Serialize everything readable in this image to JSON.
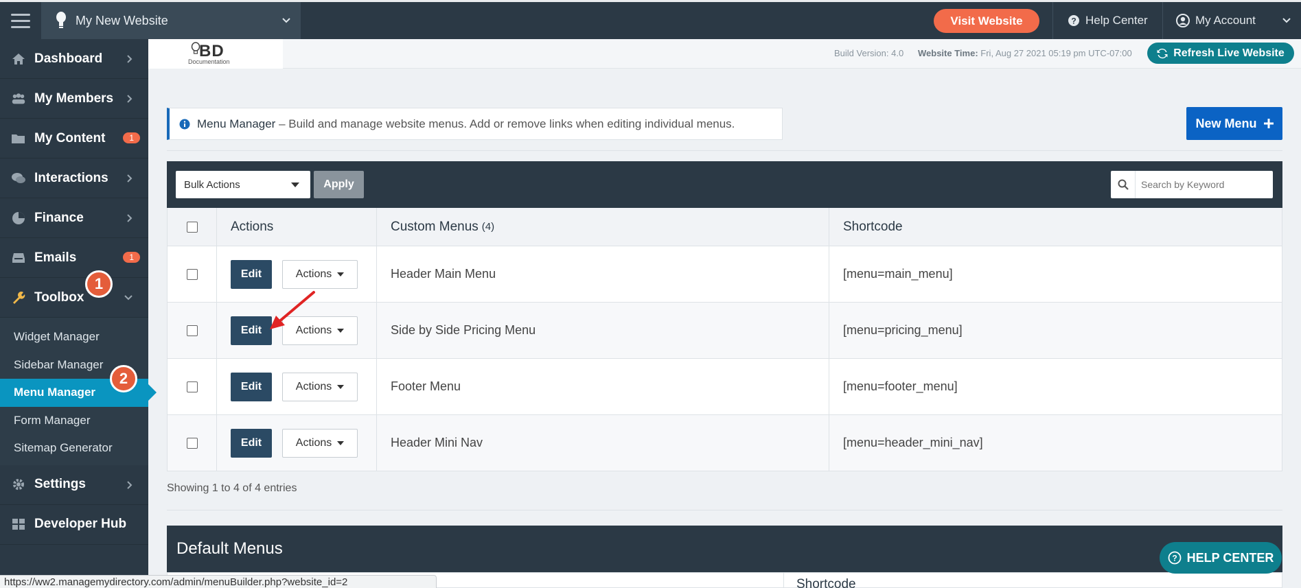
{
  "topbar": {
    "site_name": "My New Website",
    "visit_label": "Visit Website",
    "help_label": "Help Center",
    "account_label": "My Account"
  },
  "sidebar": {
    "items": [
      {
        "label": "Dashboard",
        "icon": "home-icon"
      },
      {
        "label": "My Members",
        "icon": "users-icon"
      },
      {
        "label": "My Content",
        "icon": "folder-icon",
        "badge": "1"
      },
      {
        "label": "Interactions",
        "icon": "comments-icon"
      },
      {
        "label": "Finance",
        "icon": "pie-chart-icon"
      },
      {
        "label": "Emails",
        "icon": "inbox-icon",
        "badge": "1"
      },
      {
        "label": "Toolbox",
        "icon": "wrench-icon"
      }
    ],
    "toolbox_sub": [
      "Widget Manager",
      "Sidebar Manager",
      "Menu Manager",
      "Form Manager",
      "Sitemap Generator"
    ],
    "items_after": [
      {
        "label": "Settings",
        "icon": "gear-icon"
      },
      {
        "label": "Developer Hub",
        "icon": "grid-icon"
      }
    ],
    "step1": "1",
    "step2": "2"
  },
  "header": {
    "logo_text": "BD",
    "logo_sub": "Documentation",
    "build_label": "Build Version:",
    "build_value": "4.0",
    "time_label": "Website Time:",
    "time_value": "Fri, Aug 27 2021 05:19 pm UTC-07:00",
    "refresh_label": "Refresh Live Website"
  },
  "info": {
    "title": "Menu Manager",
    "description": "– Build and manage website menus. Add or remove links when editing individual menus.",
    "new_menu_label": "New Menu"
  },
  "toolbar": {
    "bulk_actions": "Bulk Actions",
    "apply": "Apply",
    "search_placeholder": "Search by Keyword"
  },
  "table": {
    "headers": {
      "actions": "Actions",
      "custom_menus": "Custom Menus",
      "count": "(4)",
      "shortcode": "Shortcode"
    },
    "edit_label": "Edit",
    "actions_label": "Actions",
    "rows": [
      {
        "name": "Header Main Menu",
        "shortcode": "[menu=main_menu]"
      },
      {
        "name": "Side by Side Pricing Menu",
        "shortcode": "[menu=pricing_menu]"
      },
      {
        "name": "Footer Menu",
        "shortcode": "[menu=footer_menu]"
      },
      {
        "name": "Header Mini Nav",
        "shortcode": "[menu=header_mini_nav]"
      }
    ],
    "showing": "Showing 1 to 4 of 4 entries"
  },
  "default_menus": {
    "title": "Default Menus",
    "shortcode_header": "Shortcode"
  },
  "statusbar": {
    "url": "https://ww2.managemydirectory.com/admin/menuBuilder.php?website_id=2"
  },
  "help_float": {
    "label": "HELP CENTER"
  },
  "colors": {
    "navy": "#2b3945",
    "accent_orange": "#f26b4a",
    "teal": "#0e7f8d",
    "active_blue": "#0a95c0",
    "primary_blue": "#0b63c4"
  }
}
